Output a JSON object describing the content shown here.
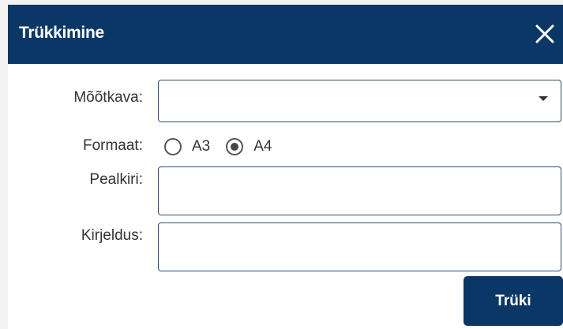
{
  "dialog": {
    "title": "Trükkimine",
    "close_icon": "close-icon"
  },
  "form": {
    "scale_label": "Mõõtkava:",
    "scale_value": "",
    "format_label": "Formaat:",
    "format_options": [
      {
        "label": "A3",
        "checked": false
      },
      {
        "label": "A4",
        "checked": true
      }
    ],
    "heading_label": "Pealkiri:",
    "heading_value": "",
    "description_label": "Kirjeldus:",
    "description_value": ""
  },
  "actions": {
    "print_label": "Trüki"
  },
  "colors": {
    "header_bg": "#0a3766",
    "field_border": "#2b4c72"
  }
}
